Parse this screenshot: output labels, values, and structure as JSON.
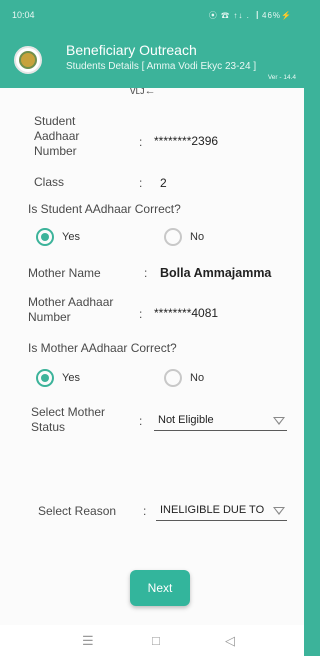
{
  "status_bar": {
    "time": "10:04",
    "icons_text": "⦿ ☎ ↑↓ .▕ 46%⚡"
  },
  "app_bar": {
    "title": "Beneficiary Outreach",
    "subtitle": "Students Details [ Amma Vodi Ekyc 23-24 ]",
    "version": "Ver - 14.4"
  },
  "form": {
    "top_partial_text": "ᴠʟᴊ←",
    "student_aadhaar": {
      "label_lines": [
        "Student",
        "Aadhaar",
        "Number"
      ],
      "colon": ":",
      "value": "********2396"
    },
    "class": {
      "label": "Class",
      "colon": ":",
      "value": "2"
    },
    "student_question": "Is Student AAdhaar  Correct?",
    "student_yes": "Yes",
    "student_no": "No",
    "mother_name": {
      "label": "Mother Name",
      "colon": ":",
      "value": "Bolla Ammajamma"
    },
    "mother_aadhaar": {
      "label_lines": [
        "Mother Aadhaar",
        "Number"
      ],
      "colon": ":",
      "value": "********4081"
    },
    "mother_question": "Is Mother AAdhaar  Correct?",
    "mother_yes": "Yes",
    "mother_no": "No",
    "mother_status": {
      "label_lines": [
        "Select Mother",
        "Status"
      ],
      "colon": ":",
      "value": "Not Eligible"
    },
    "reason": {
      "label": "Select Reason",
      "colon": ":",
      "value": "INELIGIBLE DUE TO"
    }
  },
  "buttons": {
    "next": "Next"
  },
  "nav_bar": {
    "menu": "☰",
    "home": "□",
    "back": "◁"
  }
}
